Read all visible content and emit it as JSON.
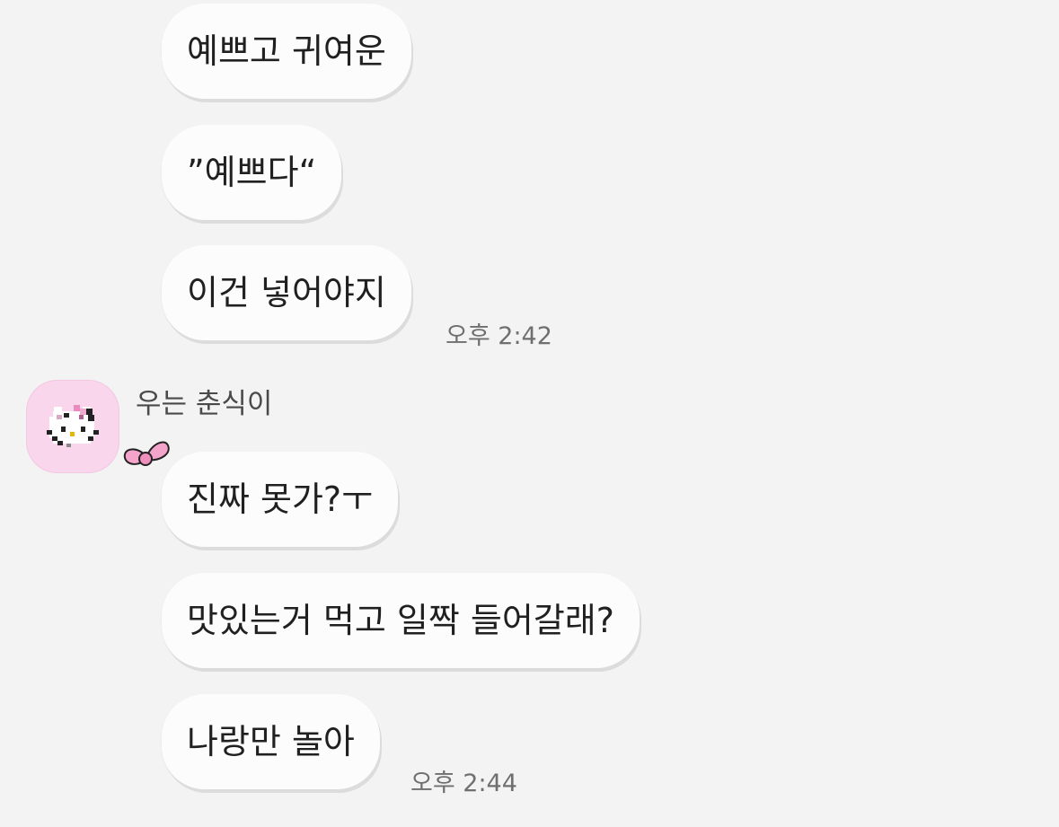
{
  "messages_mine_prev": [
    {
      "text": "예쁘고 귀여운"
    },
    {
      "text": "”예쁘다“"
    },
    {
      "text": "이건 넣어야지"
    }
  ],
  "time_1": "오후 2:42",
  "sender": {
    "name": "우는 춘식이",
    "avatar_icon": "hello-kitty-pixel-avatar",
    "badge_icon": "pink-bow-icon"
  },
  "messages_sender": [
    {
      "text": "진짜 못가?ㅜ"
    },
    {
      "text": "맛있는거 먹고 일짝 들어갈래?"
    },
    {
      "text": "나랑만 놀아"
    }
  ],
  "time_2": "오후 2:44",
  "colors": {
    "background": "#f3f3f3",
    "bubble": "#fcfcfc",
    "avatar_bg": "#f9d6ec",
    "bow": "#f4a3cb"
  }
}
